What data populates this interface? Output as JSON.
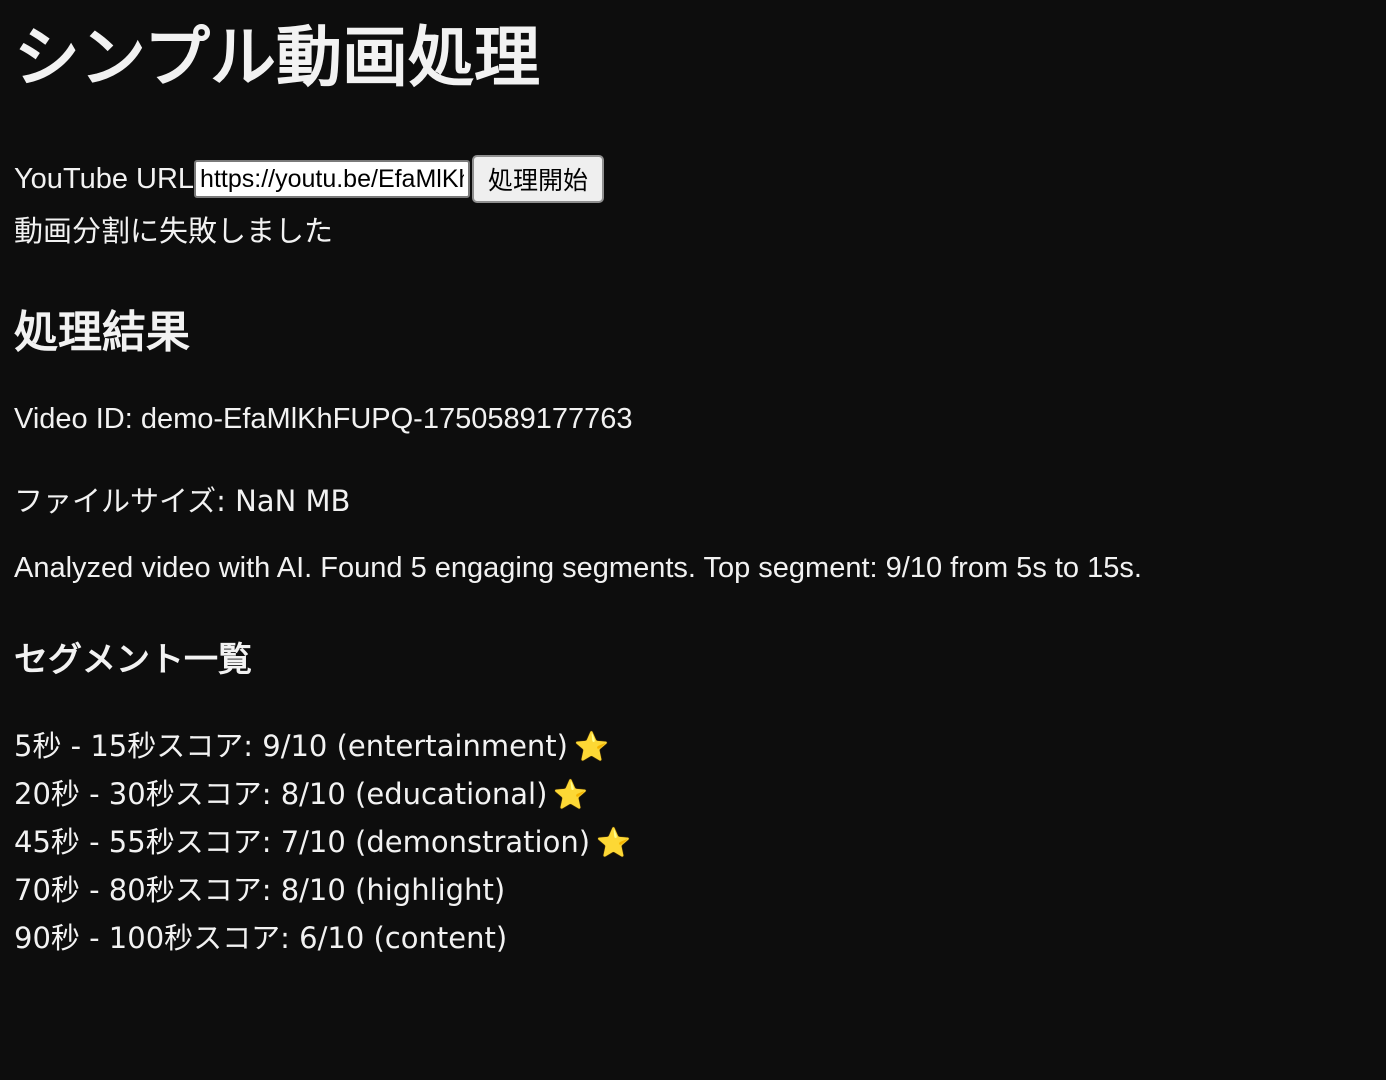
{
  "page": {
    "title": "シンプル動画処理"
  },
  "form": {
    "url_label": "YouTube URL",
    "url_value": "https://youtu.be/EfaMlKhFUPQ",
    "submit_label": "処理開始"
  },
  "status": {
    "error": "動画分割に失敗しました"
  },
  "result": {
    "heading": "処理結果",
    "video_id": "Video ID: demo-EfaMlKhFUPQ-1750589177763",
    "file_size": "ファイルサイズ: NaN MB",
    "analysis": "Analyzed video with AI. Found 5 engaging segments. Top segment: 9/10 from 5s to 15s."
  },
  "segments": {
    "heading": "セグメント一覧",
    "items": [
      {
        "text": "5秒 - 15秒スコア: 9/10 (entertainment)",
        "star": "⭐",
        "star_icon": "star-icon"
      },
      {
        "text": "20秒 - 30秒スコア: 8/10 (educational)",
        "star": "⭐",
        "star_icon": "star-icon"
      },
      {
        "text": "45秒 - 55秒スコア: 7/10 (demonstration)",
        "star": "⭐",
        "star_icon": "star-icon"
      },
      {
        "text": "70秒 - 80秒スコア: 8/10 (highlight)",
        "star": ""
      },
      {
        "text": "90秒 - 100秒スコア: 6/10 (content)",
        "star": ""
      }
    ]
  },
  "colors": {
    "background": "#0d0d0d",
    "text": "#f2f2f2",
    "star": "#ffc83d"
  }
}
